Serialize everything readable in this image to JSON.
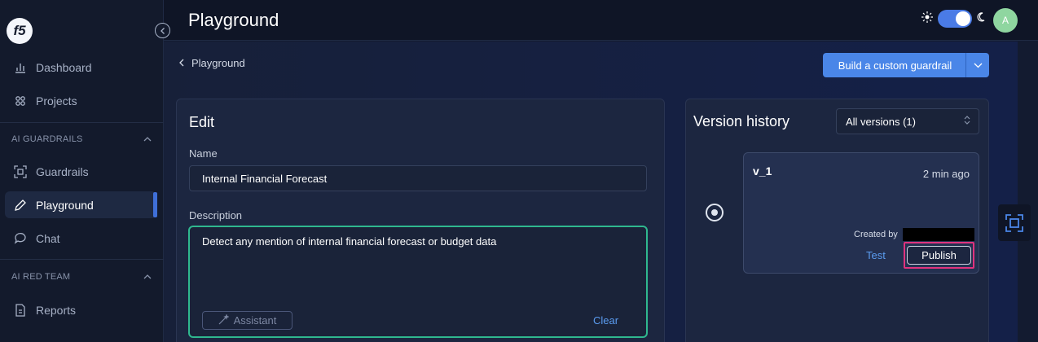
{
  "app": {
    "logo_text": "f5"
  },
  "header": {
    "title": "Playground",
    "avatar_initial": "A"
  },
  "sidebar": {
    "items_top": [
      {
        "label": "Dashboard",
        "icon": "bar-chart-icon"
      },
      {
        "label": "Projects",
        "icon": "projects-icon"
      }
    ],
    "section_guardrails": "AI GUARDRAILS",
    "items_guardrails": [
      {
        "label": "Guardrails",
        "icon": "guardrails-icon"
      },
      {
        "label": "Playground",
        "icon": "pen-icon",
        "active": true
      },
      {
        "label": "Chat",
        "icon": "chat-icon"
      }
    ],
    "section_red_team": "AI RED TEAM",
    "items_red_team": [
      {
        "label": "Reports",
        "icon": "report-icon"
      }
    ]
  },
  "breadcrumb": {
    "label": "Playground"
  },
  "actions": {
    "build_label": "Build a custom guardrail"
  },
  "edit": {
    "title": "Edit",
    "name_label": "Name",
    "name_value": "Internal Financial Forecast",
    "description_label": "Description",
    "description_value": "Detect any mention of internal financial forecast or budget data",
    "assistant_label": "Assistant",
    "clear_label": "Clear"
  },
  "versions": {
    "title": "Version history",
    "filter_value": "All versions (1)",
    "items": [
      {
        "name": "v_1",
        "time": "2 min ago",
        "created_by_label": "Created by",
        "test_label": "Test",
        "publish_label": "Publish",
        "selected": true
      }
    ]
  },
  "colors": {
    "accent": "#4a86e8",
    "success_border": "#2fb88f",
    "highlight": "#e0337e",
    "link": "#5b9cf0"
  }
}
